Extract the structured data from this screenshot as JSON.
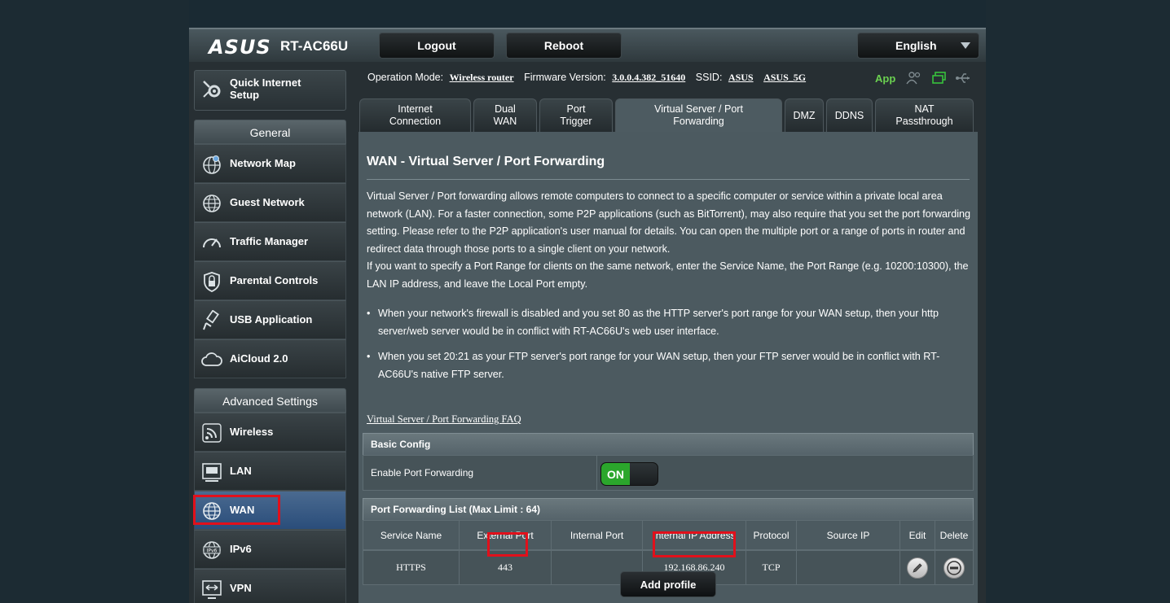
{
  "header": {
    "brand": "ASUS",
    "model": "RT-AC66U",
    "logout_label": "Logout",
    "reboot_label": "Reboot",
    "language": "English"
  },
  "sidebar": {
    "quick_setup": "Quick Internet Setup",
    "general_title": "General",
    "general_items": [
      {
        "label": "Network Map",
        "icon": "network-map-icon"
      },
      {
        "label": "Guest Network",
        "icon": "globe-icon"
      },
      {
        "label": "Traffic Manager",
        "icon": "gauge-icon"
      },
      {
        "label": "Parental Controls",
        "icon": "lock-shield-icon"
      },
      {
        "label": "USB Application",
        "icon": "usb-icon"
      },
      {
        "label": "AiCloud 2.0",
        "icon": "cloud-icon"
      }
    ],
    "advanced_title": "Advanced Settings",
    "advanced_items": [
      {
        "label": "Wireless",
        "icon": "wireless-icon"
      },
      {
        "label": "LAN",
        "icon": "lan-icon"
      },
      {
        "label": "WAN",
        "icon": "globe-icon",
        "active": true
      },
      {
        "label": "IPv6",
        "icon": "ipv6-icon"
      },
      {
        "label": "VPN",
        "icon": "vpn-icon"
      }
    ]
  },
  "status": {
    "op_mode_label": "Operation Mode:",
    "op_mode_value": "Wireless router",
    "firmware_label": "Firmware Version:",
    "firmware_value": "3.0.0.4.382_51640",
    "ssid_label": "SSID:",
    "ssid_1": "ASUS",
    "ssid_2": "ASUS_5G",
    "app_label": "App"
  },
  "tabs": [
    {
      "line1": "Internet",
      "line2": "Connection"
    },
    {
      "line1": "Dual",
      "line2": "WAN"
    },
    {
      "line1": "Port",
      "line2": "Trigger"
    },
    {
      "line1": "Virtual Server / Port",
      "line2": "Forwarding",
      "selected": true
    },
    {
      "line1": "DMZ",
      "line2": ""
    },
    {
      "line1": "DDNS",
      "line2": ""
    },
    {
      "line1": "NAT",
      "line2": "Passthrough"
    }
  ],
  "content": {
    "title": "WAN - Virtual Server / Port Forwarding",
    "description_1": "Virtual Server / Port forwarding allows remote computers to connect to a specific computer or service within a private local area network (LAN). For a faster connection, some P2P applications (such as BitTorrent), may also require that you set the port forwarding setting. Please refer to the P2P application's user manual for details. You can open the multiple port or a range of ports in router and redirect data through those ports to a single client on your network.",
    "description_2": "If you want to specify a Port Range for clients on the same network, enter the Service Name, the Port Range (e.g. 10200:10300), the LAN IP address, and leave the Local Port empty.",
    "bullet_1": "When your network's firewall is disabled and you set 80 as the HTTP server's port range for your WAN setup, then your http server/web server would be in conflict with RT-AC66U's web user interface.",
    "bullet_2": "When you set 20:21 as your FTP server's port range for your WAN setup, then your FTP server would be in conflict with RT-AC66U's native FTP server.",
    "faq_link": "Virtual Server / Port Forwarding FAQ"
  },
  "basic_config": {
    "header": "Basic Config",
    "enable_label": "Enable Port Forwarding",
    "toggle_state": "ON"
  },
  "pf_list": {
    "header": "Port Forwarding List (Max Limit : 64)",
    "columns": [
      "Service Name",
      "External Port",
      "Internal Port",
      "Internal IP Address",
      "Protocol",
      "Source IP",
      "Edit",
      "Delete"
    ],
    "rows": [
      {
        "service": "HTTPS",
        "external_port": "443",
        "internal_port": "",
        "ip": "192.168.86.240",
        "protocol": "TCP",
        "source_ip": ""
      }
    ],
    "add_label": "Add profile"
  }
}
